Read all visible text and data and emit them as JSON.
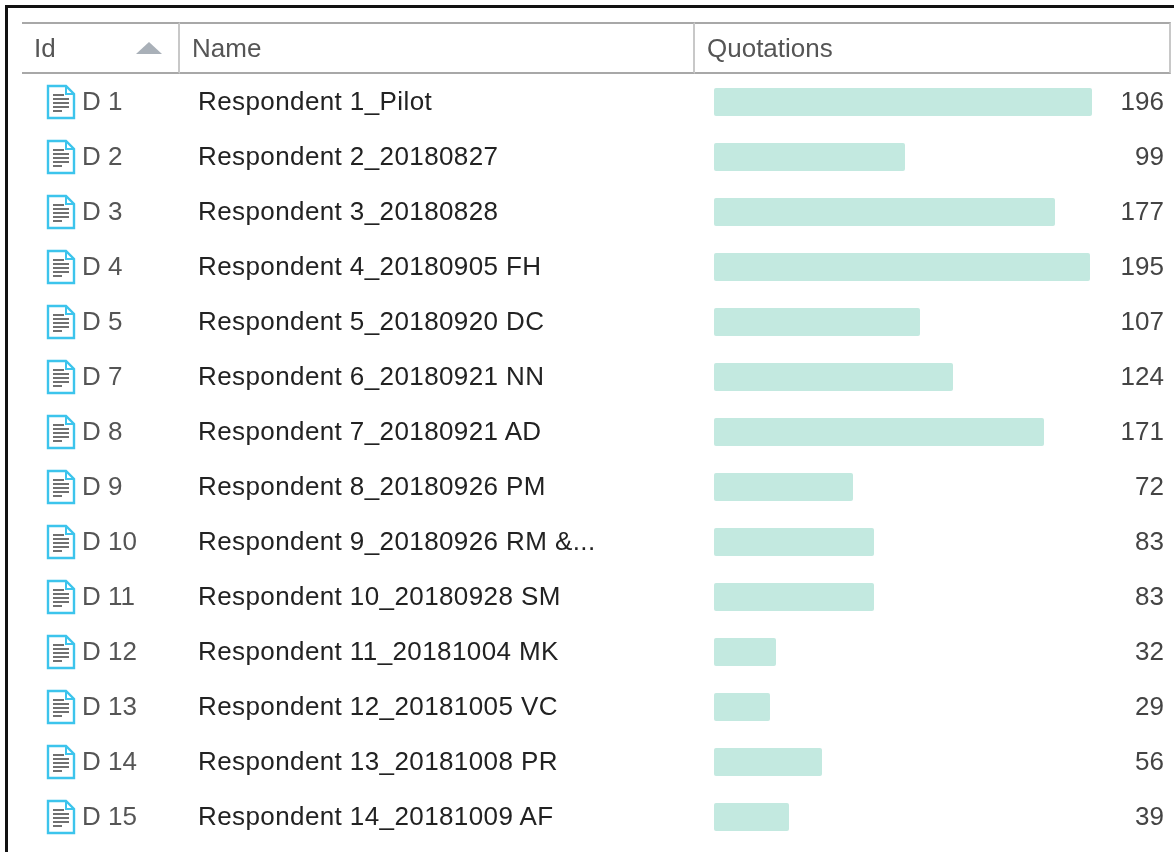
{
  "table": {
    "columns": [
      {
        "label": "Id",
        "sorted": true
      },
      {
        "label": "Name",
        "sorted": false
      },
      {
        "label": "Quotations",
        "sorted": false
      }
    ],
    "rows": [
      {
        "id": "D 1",
        "name": "Respondent 1_Pilot",
        "quotations": "196"
      },
      {
        "id": "D 2",
        "name": "Respondent 2_20180827",
        "quotations": "99"
      },
      {
        "id": "D 3",
        "name": "Respondent 3_20180828",
        "quotations": "177"
      },
      {
        "id": "D 4",
        "name": "Respondent 4_20180905 FH",
        "quotations": "195"
      },
      {
        "id": "D 5",
        "name": "Respondent 5_20180920 DC",
        "quotations": "107"
      },
      {
        "id": "D 7",
        "name": "Respondent 6_20180921 NN",
        "quotations": "124"
      },
      {
        "id": "D 8",
        "name": "Respondent 7_20180921 AD",
        "quotations": "171"
      },
      {
        "id": "D 9",
        "name": "Respondent 8_20180926 PM",
        "quotations": "72"
      },
      {
        "id": "D 10",
        "name": "Respondent 9_20180926 RM &...",
        "quotations": "83"
      },
      {
        "id": "D 11",
        "name": "Respondent 10_20180928 SM",
        "quotations": "83"
      },
      {
        "id": "D 12",
        "name": "Respondent 11_20181004 MK",
        "quotations": "32"
      },
      {
        "id": "D 13",
        "name": "Respondent 12_20181005 VC",
        "quotations": "29"
      },
      {
        "id": "D 14",
        "name": "Respondent 13_20181008 PR",
        "quotations": "56"
      },
      {
        "id": "D 15",
        "name": "Respondent 14_20181009 AF",
        "quotations": "39"
      }
    ]
  }
}
